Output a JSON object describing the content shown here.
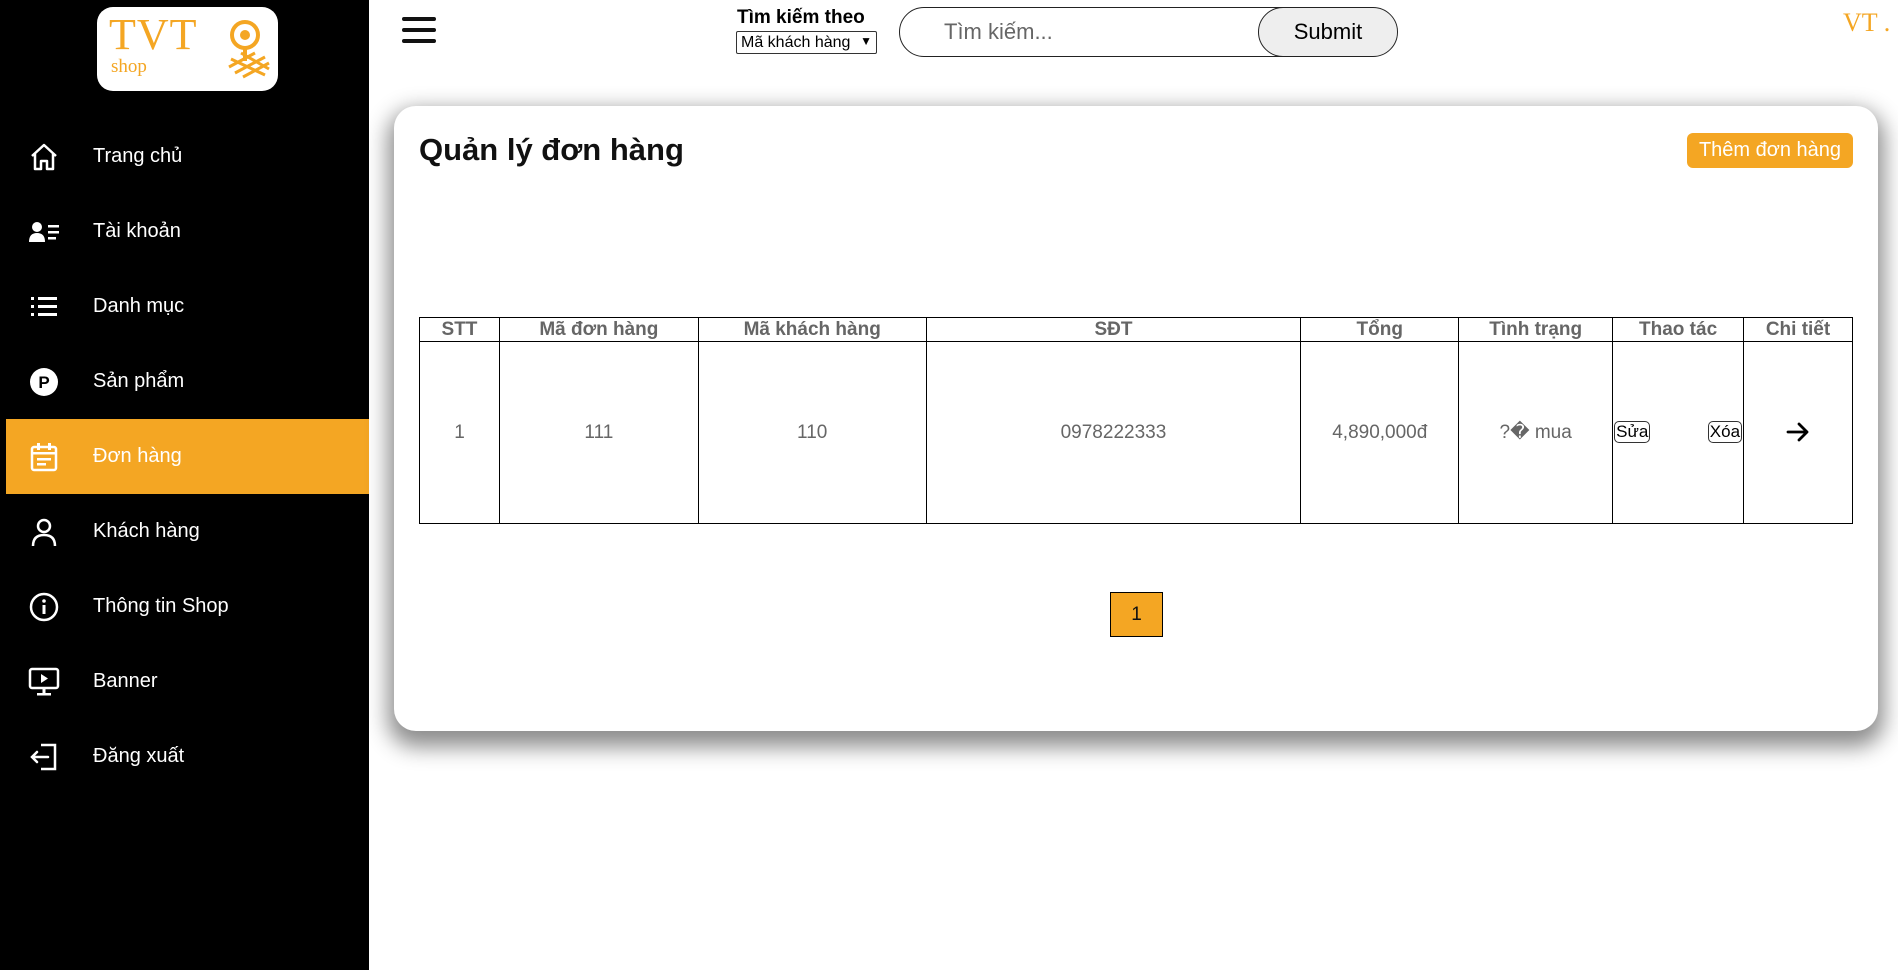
{
  "logo": {
    "main": "TVT",
    "sub": "shop"
  },
  "sidebar": {
    "items": [
      {
        "label": "Trang chủ",
        "icon": "home-icon"
      },
      {
        "label": "Tài khoản",
        "icon": "account-card-icon"
      },
      {
        "label": "Danh mục",
        "icon": "list-icon"
      },
      {
        "label": "Sản phẩm",
        "icon": "product-p-icon"
      },
      {
        "label": "Đơn hàng",
        "icon": "order-calendar-icon",
        "active": true
      },
      {
        "label": "Khách hàng",
        "icon": "user-icon"
      },
      {
        "label": "Thông tin Shop",
        "icon": "info-icon"
      },
      {
        "label": "Banner",
        "icon": "monitor-icon"
      },
      {
        "label": "Đăng xuất",
        "icon": "logout-icon"
      }
    ]
  },
  "topbar": {
    "search_by_label": "Tìm kiếm theo",
    "search_by_selected": "Mã khách hàng",
    "search_placeholder": "Tìm kiếm...",
    "submit_label": "Submit",
    "brand_fragment": "VT ."
  },
  "main": {
    "title": "Quản lý đơn hàng",
    "add_button": "Thêm đơn hàng",
    "table": {
      "headers": [
        "STT",
        "Mã đơn hàng",
        "Mã khách hàng",
        "SĐT",
        "Tổng",
        "Tình trạng",
        "Thao tác",
        "Chi tiết"
      ],
      "rows": [
        {
          "stt": "1",
          "order_id": "111",
          "customer_id": "110",
          "phone": "0978222333",
          "total": "4,890,000đ",
          "status": "?� mua",
          "edit": "Sửa",
          "delete": "Xóa"
        }
      ]
    },
    "pagination": {
      "current": "1"
    }
  },
  "colors": {
    "accent": "#f4a623",
    "sidebar_bg": "#000000"
  }
}
